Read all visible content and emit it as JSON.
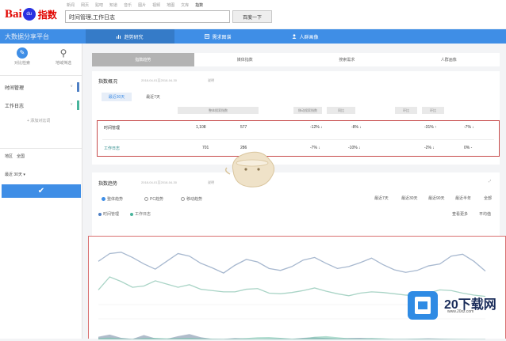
{
  "header": {
    "logo_bai": "Bai",
    "logo_paw": "du",
    "logo_zhishu": "指数",
    "topnav": [
      "新闻",
      "网页",
      "贴吧",
      "知道",
      "音乐",
      "图片",
      "视频",
      "地图",
      "文库",
      "指数"
    ],
    "search_value": "时间管理,工作日志",
    "search_button": "百度一下"
  },
  "navbar": {
    "slogan": "大数据分享平台",
    "tabs": [
      {
        "label": "趋势研究",
        "icon": "trend-icon"
      },
      {
        "label": "需求图谱",
        "icon": "graph-icon"
      },
      {
        "label": "人群画像",
        "icon": "user-icon"
      }
    ]
  },
  "sidebar": {
    "icon_a_label": "对比检索",
    "icon_b_label": "地域筛选",
    "keywords": [
      {
        "label": "时间管理",
        "color": "#4e7fc4"
      },
      {
        "label": "工作日志",
        "color": "#49b49c"
      }
    ],
    "add_link": "+ 添加对比词",
    "region_label": "地区",
    "region_value": "全国",
    "range_label": "最近",
    "range_value": "30天",
    "confirm_icon": "check-icon"
  },
  "subtabs": [
    "指数趋势",
    "媒体指数",
    "搜索需求",
    "人群画像"
  ],
  "overview": {
    "title": "指数概况",
    "date": "2018-04-01至2018-04-30",
    "help": "说明",
    "pills": [
      "最近30天",
      "最近7天"
    ],
    "colheads": [
      "整体搜索指数",
      "移动搜索指数",
      "同比",
      "环比"
    ],
    "rows": [
      {
        "name": "时间管理",
        "v1": "1,108",
        "v2": "577",
        "v3": "-12% ↓",
        "v4": "-8% ↓",
        "v5": "-31% ↑",
        "v6": "-7% ↓"
      },
      {
        "name": "工作日志",
        "v1": "701",
        "v2": "286",
        "v3": "-7% ↓",
        "v4": "-10% ↓",
        "v5": "-2% ↓",
        "v6": "0% -"
      }
    ]
  },
  "trend": {
    "title": "指数趋势",
    "date": "2018-04-01至2018-04-30",
    "help": "说明",
    "radios": [
      "整体趋势",
      "PC趋势",
      "移动趋势"
    ],
    "ranges": [
      "最近7天",
      "最近30天",
      "最近90天",
      "最近半年",
      "全部"
    ],
    "legend": [
      {
        "label": "时间管理",
        "color": "#4e7fc4"
      },
      {
        "label": "工作日志",
        "color": "#49b49c"
      }
    ],
    "link_a": "查看更多",
    "link_b": "平均值"
  },
  "chart_data": {
    "type": "line",
    "series": [
      {
        "name": "时间管理",
        "color": "#a7b8cf",
        "values": [
          0.74,
          0.86,
          0.88,
          0.8,
          0.7,
          0.62,
          0.74,
          0.86,
          0.82,
          0.71,
          0.64,
          0.56,
          0.68,
          0.77,
          0.73,
          0.63,
          0.6,
          0.66,
          0.76,
          0.8,
          0.71,
          0.63,
          0.66,
          0.72,
          0.79,
          0.69,
          0.61,
          0.57,
          0.6,
          0.67,
          0.7,
          0.82,
          0.85,
          0.74,
          0.59
        ]
      },
      {
        "name": "工作日志",
        "color": "#a9d4c6",
        "values": [
          0.3,
          0.5,
          0.43,
          0.34,
          0.36,
          0.44,
          0.39,
          0.34,
          0.38,
          0.31,
          0.29,
          0.27,
          0.27,
          0.31,
          0.32,
          0.25,
          0.24,
          0.26,
          0.29,
          0.33,
          0.28,
          0.24,
          0.21,
          0.25,
          0.27,
          0.26,
          0.24,
          0.22,
          0.21,
          0.25,
          0.3,
          0.29,
          0.25,
          0.22,
          0.2
        ]
      }
    ],
    "lower_series": [
      {
        "color": "#7b8fa8",
        "values": [
          0.1,
          0.18,
          0.06,
          0.02,
          0.16,
          0.04,
          0.02,
          0.12,
          0.2,
          0.08,
          0.02,
          0.02,
          0.05,
          0.03,
          0.01,
          0.02,
          0.04,
          0.02,
          0.06,
          0.08,
          0.05,
          0.03,
          0.05,
          0.06,
          0.04,
          0.02,
          0.02,
          0.02,
          0.03,
          0.04,
          0.03,
          0.02,
          0.01,
          0.01,
          0.01
        ]
      },
      {
        "color": "#7fc7b0",
        "values": [
          0.05,
          0.07,
          0.04,
          0.02,
          0.05,
          0.06,
          0.04,
          0.05,
          0.06,
          0.04,
          0.03,
          0.02,
          0.03,
          0.05,
          0.08,
          0.09,
          0.06,
          0.03,
          0.04,
          0.1,
          0.12,
          0.08,
          0.04,
          0.03,
          0.05,
          0.04,
          0.02,
          0.02,
          0.03,
          0.02,
          0.02,
          0.02,
          0.02,
          0.01,
          0.01
        ]
      }
    ]
  },
  "watermark": {
    "brand": "20下载网",
    "url": "www.20xz.com"
  }
}
